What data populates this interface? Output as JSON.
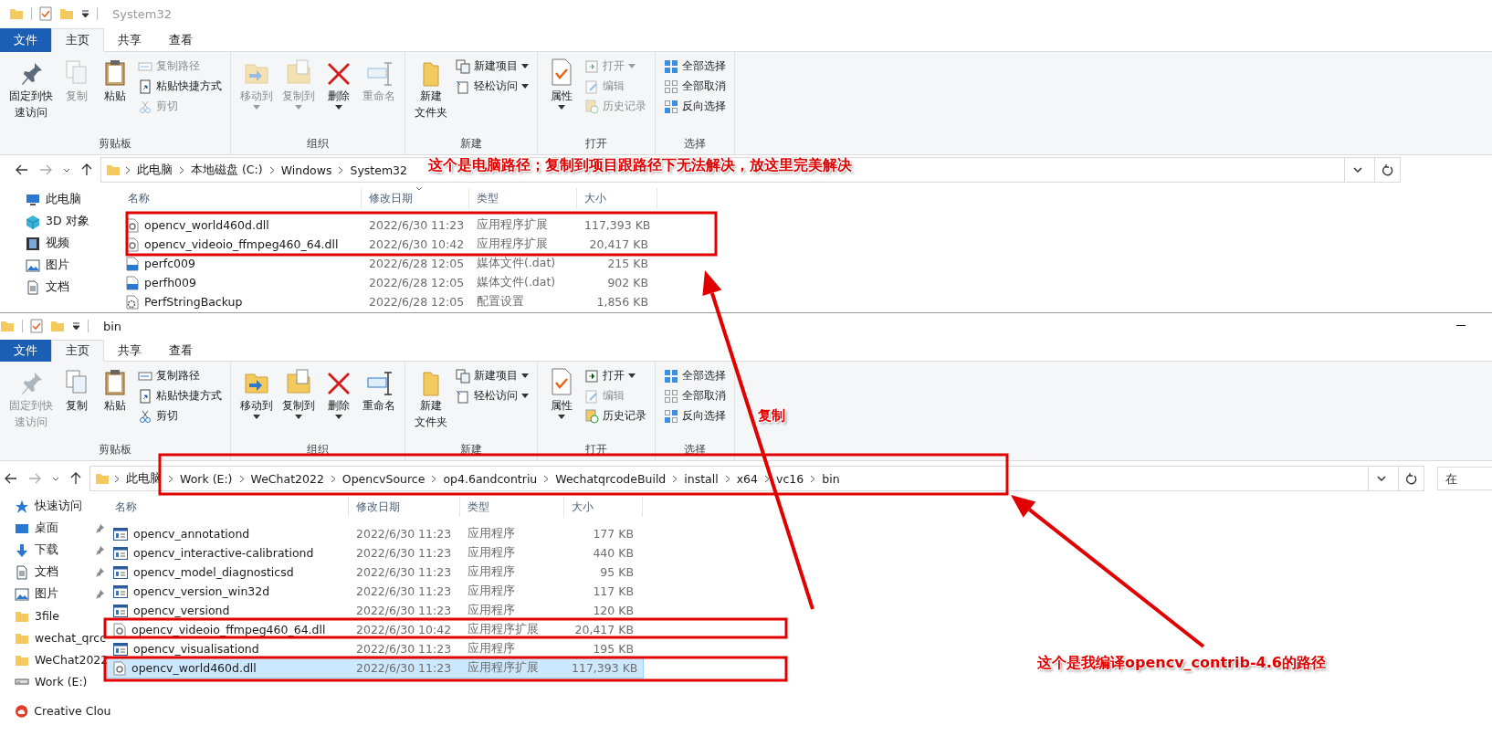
{
  "windows": [
    {
      "title": "System32",
      "tabs": [
        {
          "label": "文件",
          "kind": "file",
          "selected": false
        },
        {
          "label": "主页",
          "kind": "plain",
          "selected": true
        },
        {
          "label": "共享",
          "kind": "plain",
          "selected": false
        },
        {
          "label": "查看",
          "kind": "plain",
          "selected": false
        }
      ],
      "ribbon": [
        {
          "label": "剪贴板",
          "items": [
            {
              "lines": [
                "固定到快",
                "速访问"
              ],
              "kind": "large",
              "disabled": false
            },
            {
              "label": "复制",
              "kind": "large",
              "disabled": true
            },
            {
              "label": "粘贴",
              "kind": "large",
              "disabled": false
            },
            {
              "label": "复制路径",
              "kind": "small",
              "disabled": true
            },
            {
              "label": "粘贴快捷方式",
              "kind": "small",
              "disabled": false
            },
            {
              "label": "剪切",
              "kind": "small",
              "disabled": true
            }
          ]
        },
        {
          "label": "组织",
          "items": [
            {
              "label": "移动到",
              "kind": "large",
              "disabled": true,
              "dropdown": true
            },
            {
              "label": "复制到",
              "kind": "large",
              "disabled": true,
              "dropdown": true
            },
            {
              "label": "删除",
              "kind": "large",
              "disabled": false,
              "dropdown": true
            },
            {
              "label": "重命名",
              "kind": "large",
              "disabled": true
            }
          ]
        },
        {
          "label": "新建",
          "items": [
            {
              "lines": [
                "新建",
                "文件夹"
              ],
              "kind": "large",
              "disabled": false
            },
            {
              "label": "新建项目",
              "kind": "small",
              "disabled": false,
              "dropdown": true
            },
            {
              "label": "轻松访问",
              "kind": "small",
              "disabled": false,
              "dropdown": true
            }
          ]
        },
        {
          "label": "打开",
          "items": [
            {
              "label": "属性",
              "kind": "large",
              "disabled": false,
              "dropdown": true
            },
            {
              "label": "打开",
              "kind": "small",
              "disabled": true,
              "dropdown": true
            },
            {
              "label": "编辑",
              "kind": "small",
              "disabled": true
            },
            {
              "label": "历史记录",
              "kind": "small",
              "disabled": true
            }
          ]
        },
        {
          "label": "选择",
          "items": [
            {
              "label": "全部选择",
              "kind": "small",
              "disabled": false
            },
            {
              "label": "全部取消",
              "kind": "small",
              "disabled": false
            },
            {
              "label": "反向选择",
              "kind": "small",
              "disabled": false
            }
          ]
        }
      ],
      "crumbs": [
        "此电脑",
        "本地磁盘 (C:)",
        "Windows",
        "System32"
      ],
      "sidebar": [
        {
          "label": "此电脑",
          "kind": "pc",
          "pinned": false
        },
        {
          "label": "3D 对象",
          "kind": "cube",
          "pinned": false
        },
        {
          "label": "视频",
          "kind": "video",
          "pinned": false
        },
        {
          "label": "图片",
          "kind": "pictures",
          "pinned": false
        },
        {
          "label": "文档",
          "kind": "docs",
          "pinned": false
        }
      ],
      "columns": [
        {
          "label": "名称",
          "sorted": false
        },
        {
          "label": "修改日期",
          "sorted": true
        },
        {
          "label": "类型",
          "sorted": false
        },
        {
          "label": "大小",
          "sorted": false
        }
      ],
      "files": [
        {
          "name": "opencv_world460d.dll",
          "date": "2022/6/30 11:23",
          "type": "应用程序扩展",
          "size": "117,393 KB",
          "kind": "dll",
          "selected": false
        },
        {
          "name": "opencv_videoio_ffmpeg460_64.dll",
          "date": "2022/6/30 10:42",
          "type": "应用程序扩展",
          "size": "20,417 KB",
          "kind": "dll",
          "selected": false
        },
        {
          "name": "perfc009",
          "date": "2022/6/28 12:05",
          "type": "媒体文件(.dat)",
          "size": "215 KB",
          "kind": "dat",
          "selected": false
        },
        {
          "name": "perfh009",
          "date": "2022/6/28 12:05",
          "type": "媒体文件(.dat)",
          "size": "902 KB",
          "kind": "dat",
          "selected": false
        },
        {
          "name": "PerfStringBackup",
          "date": "2022/6/28 12:05",
          "type": "配置设置",
          "size": "1,856 KB",
          "kind": "config",
          "selected": false
        }
      ]
    },
    {
      "title": "bin",
      "tabs": [
        {
          "label": "文件",
          "kind": "file",
          "selected": false
        },
        {
          "label": "主页",
          "kind": "plain",
          "selected": true
        },
        {
          "label": "共享",
          "kind": "plain",
          "selected": false
        },
        {
          "label": "查看",
          "kind": "plain",
          "selected": false
        }
      ],
      "ribbon": [
        {
          "label": "剪贴板",
          "items": [
            {
              "lines": [
                "固定到快",
                "速访问"
              ],
              "kind": "large",
              "disabled": true
            },
            {
              "label": "复制",
              "kind": "large",
              "disabled": false
            },
            {
              "label": "粘贴",
              "kind": "large",
              "disabled": false
            },
            {
              "label": "复制路径",
              "kind": "small",
              "disabled": false
            },
            {
              "label": "粘贴快捷方式",
              "kind": "small",
              "disabled": false
            },
            {
              "label": "剪切",
              "kind": "small",
              "disabled": false
            }
          ]
        },
        {
          "label": "组织",
          "items": [
            {
              "label": "移动到",
              "kind": "large",
              "disabled": false,
              "dropdown": true
            },
            {
              "label": "复制到",
              "kind": "large",
              "disabled": false,
              "dropdown": true
            },
            {
              "label": "删除",
              "kind": "large",
              "disabled": false,
              "dropdown": true
            },
            {
              "label": "重命名",
              "kind": "large",
              "disabled": false
            }
          ]
        },
        {
          "label": "新建",
          "items": [
            {
              "lines": [
                "新建",
                "文件夹"
              ],
              "kind": "large",
              "disabled": false
            },
            {
              "label": "新建项目",
              "kind": "small",
              "disabled": false,
              "dropdown": true
            },
            {
              "label": "轻松访问",
              "kind": "small",
              "disabled": false,
              "dropdown": true
            }
          ]
        },
        {
          "label": "打开",
          "items": [
            {
              "label": "属性",
              "kind": "large",
              "disabled": false,
              "dropdown": true
            },
            {
              "label": "打开",
              "kind": "small",
              "disabled": false,
              "dropdown": true
            },
            {
              "label": "编辑",
              "kind": "small",
              "disabled": true
            },
            {
              "label": "历史记录",
              "kind": "small",
              "disabled": false
            }
          ]
        },
        {
          "label": "选择",
          "items": [
            {
              "label": "全部选择",
              "kind": "small",
              "disabled": false
            },
            {
              "label": "全部取消",
              "kind": "small",
              "disabled": false
            },
            {
              "label": "反向选择",
              "kind": "small",
              "disabled": false
            }
          ]
        }
      ],
      "crumbs": [
        "此电脑",
        "Work (E:)",
        "WeChat2022",
        "OpencvSource",
        "op4.6andcontriu",
        "WechatqrcodeBuild",
        "install",
        "x64",
        "vc16",
        "bin"
      ],
      "search": {
        "placeholder": "在"
      },
      "sidebar": [
        {
          "label": "快速访问",
          "kind": "star",
          "pinned": false
        },
        {
          "label": "桌面",
          "kind": "desktop",
          "pinned": true
        },
        {
          "label": "下载",
          "kind": "download",
          "pinned": true
        },
        {
          "label": "文档",
          "kind": "docs",
          "pinned": true
        },
        {
          "label": "图片",
          "kind": "pictures",
          "pinned": true
        },
        {
          "label": "3file",
          "kind": "folder",
          "pinned": false
        },
        {
          "label": "wechat_qrcc",
          "kind": "folder",
          "pinned": false
        },
        {
          "label": "WeChat2022",
          "kind": "folder",
          "pinned": false
        },
        {
          "label": "Work (E:)",
          "kind": "drive",
          "pinned": false
        },
        {
          "label": "Creative Clou",
          "kind": "cloud",
          "pinned": false
        }
      ],
      "columns": [
        {
          "label": "名称",
          "sorted": false
        },
        {
          "label": "修改日期",
          "sorted": false
        },
        {
          "label": "类型",
          "sorted": false
        },
        {
          "label": "大小",
          "sorted": false
        }
      ],
      "files": [
        {
          "name": "opencv_annotationd",
          "date": "2022/6/30 11:23",
          "type": "应用程序",
          "size": "177 KB",
          "kind": "exe",
          "selected": false
        },
        {
          "name": "opencv_interactive-calibrationd",
          "date": "2022/6/30 11:23",
          "type": "应用程序",
          "size": "440 KB",
          "kind": "exe",
          "selected": false
        },
        {
          "name": "opencv_model_diagnosticsd",
          "date": "2022/6/30 11:23",
          "type": "应用程序",
          "size": "95 KB",
          "kind": "exe",
          "selected": false
        },
        {
          "name": "opencv_version_win32d",
          "date": "2022/6/30 11:23",
          "type": "应用程序",
          "size": "117 KB",
          "kind": "exe",
          "selected": false
        },
        {
          "name": "opencv_versiond",
          "date": "2022/6/30 11:23",
          "type": "应用程序",
          "size": "120 KB",
          "kind": "exe",
          "selected": false
        },
        {
          "name": "opencv_videoio_ffmpeg460_64.dll",
          "date": "2022/6/30 10:42",
          "type": "应用程序扩展",
          "size": "20,417 KB",
          "kind": "dll",
          "selected": false
        },
        {
          "name": "opencv_visualisationd",
          "date": "2022/6/30 11:23",
          "type": "应用程序",
          "size": "195 KB",
          "kind": "exe",
          "selected": false
        },
        {
          "name": "opencv_world460d.dll",
          "date": "2022/6/30 11:23",
          "type": "应用程序扩展",
          "size": "117,393 KB",
          "kind": "dll",
          "selected": true
        }
      ]
    }
  ],
  "annotations": [
    {
      "text": "这个是电脑路径；复制到项目跟路径下无法解决，放这里完美解决"
    },
    {
      "text": "复制"
    },
    {
      "text": "这个是我编译opencv_contrib-4.6的路径"
    }
  ]
}
